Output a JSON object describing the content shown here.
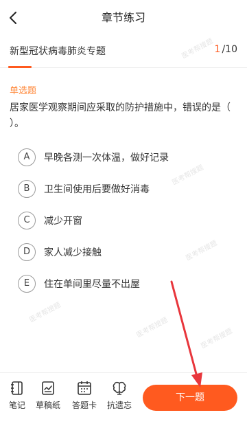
{
  "header": {
    "title": "章节练习",
    "back_icon": "chevron-left-icon"
  },
  "topic": {
    "title": "新型冠状病毒肺炎专题",
    "current": "1",
    "separator": "/",
    "total": "10",
    "progress_fraction": 0.1
  },
  "question": {
    "type": "单选题",
    "text": "居家医学观察期间应采取的防护措施中，错误的是（ ）。",
    "options": [
      {
        "letter": "A",
        "text": "早晚各测一次体温，做好记录"
      },
      {
        "letter": "B",
        "text": "卫生间使用后要做好消毒"
      },
      {
        "letter": "C",
        "text": "减少开窗"
      },
      {
        "letter": "D",
        "text": "家人减少接触"
      },
      {
        "letter": "E",
        "text": "住在单间里尽量不出屋"
      }
    ]
  },
  "watermark": {
    "text": "医考帮搜题"
  },
  "toolbar": {
    "tools": [
      {
        "label": "笔记",
        "icon": "notebook-icon"
      },
      {
        "label": "草稿纸",
        "icon": "draft-paper-icon"
      },
      {
        "label": "答题卡",
        "icon": "answer-card-icon"
      },
      {
        "label": "抗遗忘",
        "icon": "brain-icon"
      }
    ],
    "next_label": "下一题"
  },
  "colors": {
    "accent": "#ff5a1f",
    "type_label": "#ff8a3d",
    "annotation_arrow": "#e8363c"
  }
}
